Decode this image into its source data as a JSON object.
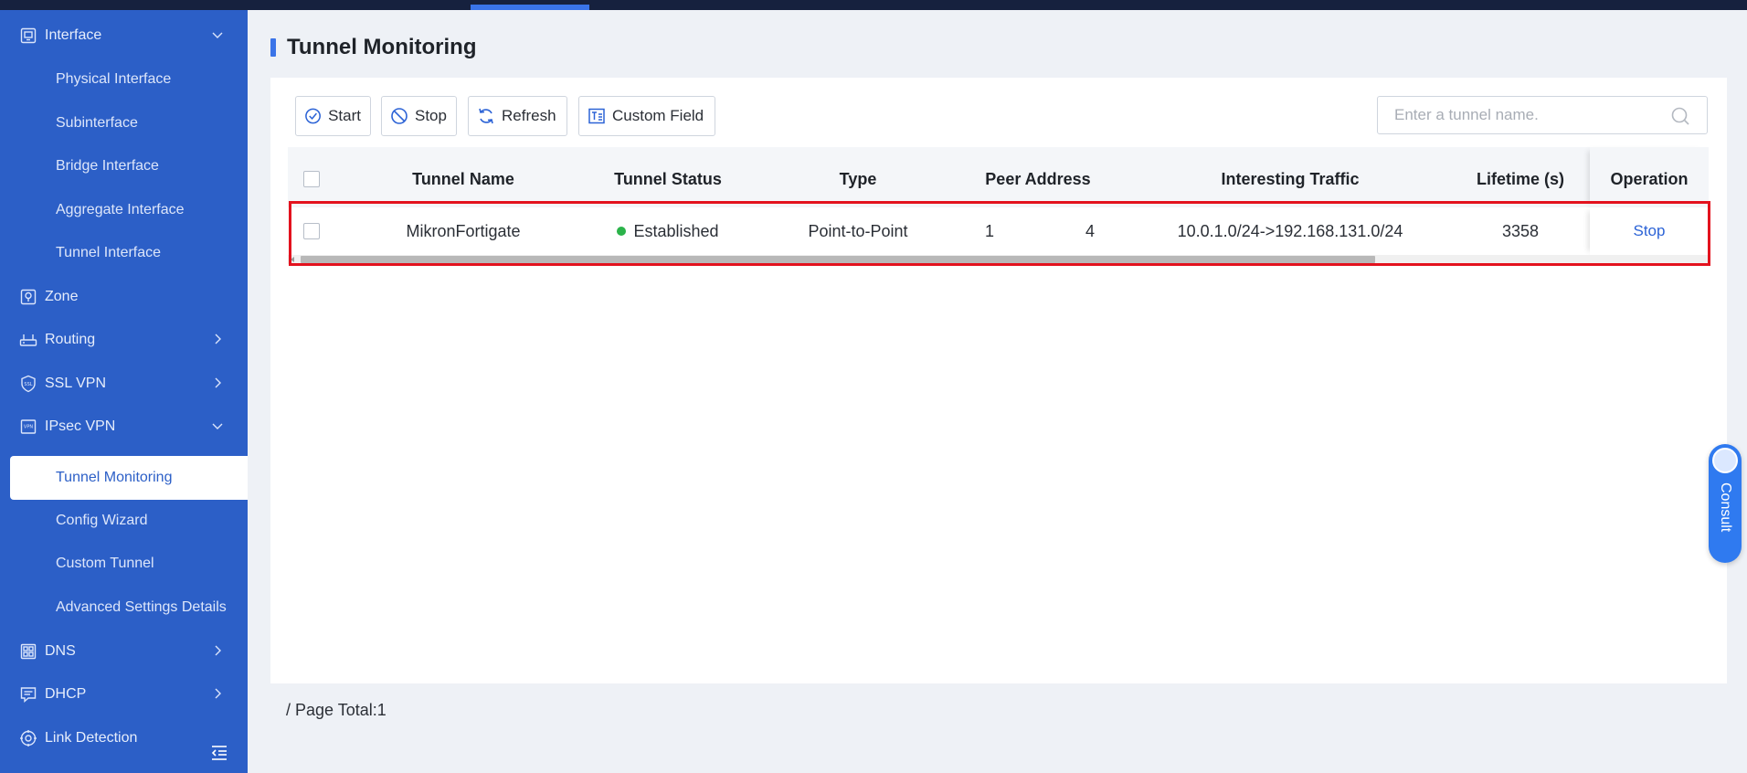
{
  "sidebar": {
    "items": [
      {
        "label": "Interface",
        "icon": "interface-icon",
        "chevron": "down"
      },
      {
        "label": "Physical Interface"
      },
      {
        "label": "Subinterface"
      },
      {
        "label": "Bridge Interface"
      },
      {
        "label": "Aggregate Interface"
      },
      {
        "label": "Tunnel Interface"
      },
      {
        "label": "Zone",
        "icon": "zone-icon"
      },
      {
        "label": "Routing",
        "icon": "routing-icon",
        "chevron": "right"
      },
      {
        "label": "SSL VPN",
        "icon": "ssl-vpn-icon",
        "chevron": "right"
      },
      {
        "label": "IPsec VPN",
        "icon": "ipsec-vpn-icon",
        "chevron": "down"
      },
      {
        "label": "Tunnel Monitoring",
        "selected": true
      },
      {
        "label": "Config Wizard"
      },
      {
        "label": "Custom Tunnel"
      },
      {
        "label": "Advanced Settings Details"
      },
      {
        "label": "DNS",
        "icon": "dns-icon",
        "chevron": "right"
      },
      {
        "label": "DHCP",
        "icon": "dhcp-icon",
        "chevron": "right"
      },
      {
        "label": "Link Detection",
        "icon": "link-detection-icon"
      }
    ]
  },
  "page": {
    "title": "Tunnel Monitoring",
    "page_total": "/ Page Total:1"
  },
  "toolbar": {
    "start_label": "Start",
    "stop_label": "Stop",
    "refresh_label": "Refresh",
    "custom_field_label": "Custom Field"
  },
  "search": {
    "placeholder": "Enter a tunnel name."
  },
  "table": {
    "headers": {
      "tunnel_name": "Tunnel Name",
      "tunnel_status": "Tunnel Status",
      "type": "Type",
      "peer_address": "Peer Address",
      "interesting_traffic": "Interesting Traffic",
      "lifetime": "Lifetime (s)",
      "operation": "Operation"
    },
    "rows": [
      {
        "tunnel_name": "MikronFortigate",
        "tunnel_status": "Established",
        "type": "Point-to-Point",
        "peer_address_a": "1",
        "peer_address_b": "4",
        "interesting_traffic": "10.0.1.0/24->192.168.131.0/24",
        "lifetime": "3358",
        "operation": "Stop"
      }
    ]
  },
  "consult": {
    "label": "Consult"
  },
  "colors": {
    "sidebar_bg": "#2c5fc7",
    "accent": "#3a74e8",
    "status_established": "#2bb34a",
    "highlight_border": "#e3121e"
  }
}
